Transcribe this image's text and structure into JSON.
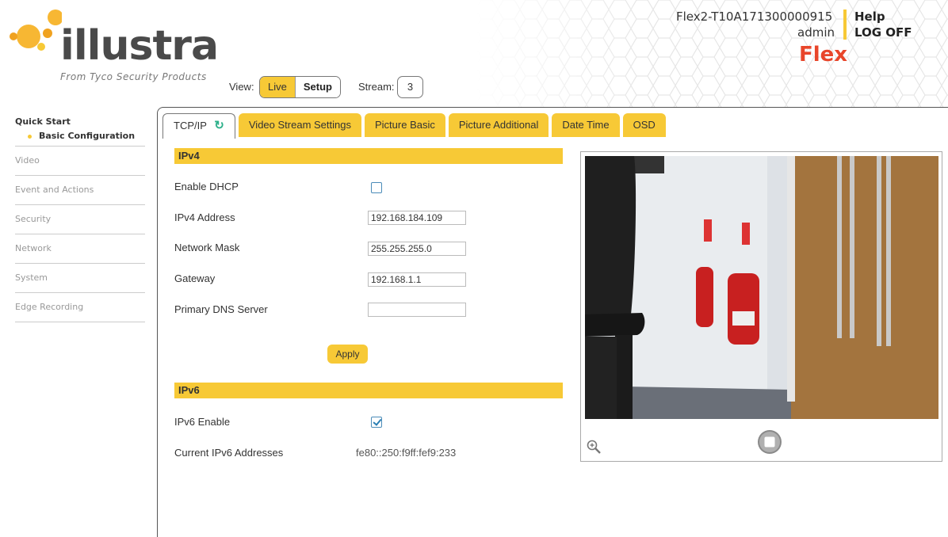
{
  "header": {
    "logo_text": "illustra",
    "logo_subtitle": "From Tyco Security Products",
    "device_name": "Flex2-T10A171300000915",
    "user": "admin",
    "help": "Help",
    "logoff": "LOG OFF",
    "product": "Flex"
  },
  "view": {
    "label": "View:",
    "live": "Live",
    "setup": "Setup",
    "stream_label": "Stream:",
    "stream_value": "3"
  },
  "sidebar": {
    "quick_start": "Quick Start",
    "basic_config": "Basic Configuration",
    "items": [
      "Video",
      "Event and Actions",
      "Security",
      "Network",
      "System",
      "Edge Recording"
    ]
  },
  "tabs": [
    "TCP/IP",
    "Video Stream Settings",
    "Picture Basic",
    "Picture Additional",
    "Date Time",
    "OSD"
  ],
  "ipv4": {
    "title": "IPv4",
    "enable_dhcp": "Enable DHCP",
    "dhcp_checked": false,
    "address_label": "IPv4 Address",
    "address": "192.168.184.109",
    "mask_label": "Network Mask",
    "mask": "255.255.255.0",
    "gateway_label": "Gateway",
    "gateway": "192.168.1.1",
    "dns_label": "Primary DNS Server",
    "dns": "",
    "apply": "Apply"
  },
  "ipv6": {
    "title": "IPv6",
    "enable_label": "IPv6 Enable",
    "enabled": true,
    "current_label": "Current IPv6 Addresses",
    "current": "fe80::250:f9ff:fef9:233"
  },
  "colors": {
    "accent": "#f7c936",
    "brand_red": "#e8452a",
    "refresh_green": "#2cb08a"
  }
}
